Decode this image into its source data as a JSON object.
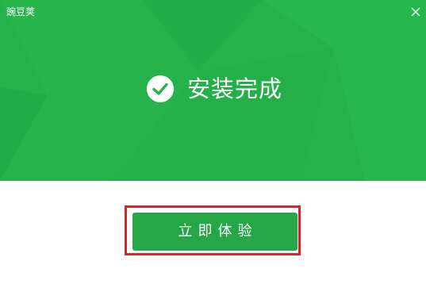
{
  "window": {
    "title": "豌豆荚",
    "close_icon": "close-icon"
  },
  "header": {
    "status_icon": "check-circle-icon",
    "status_text": "安装完成",
    "background_color": "#25b24a"
  },
  "action": {
    "button_label": "立即体验",
    "button_color": "#25a748",
    "highlight_color": "#d9222a"
  }
}
